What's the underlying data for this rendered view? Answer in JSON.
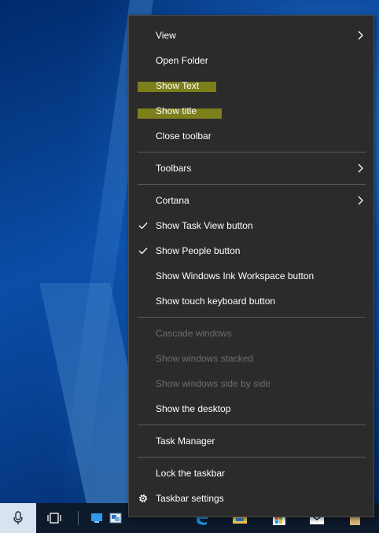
{
  "context_menu": {
    "items": [
      {
        "label": "View"
      },
      {
        "label": "Open Folder"
      },
      {
        "label": "Show Text"
      },
      {
        "label": "Show title"
      },
      {
        "label": "Close toolbar"
      },
      {
        "label": "Toolbars"
      },
      {
        "label": "Cortana"
      },
      {
        "label": "Show Task View button"
      },
      {
        "label": "Show People button"
      },
      {
        "label": "Show Windows Ink Workspace button"
      },
      {
        "label": "Show touch keyboard button"
      },
      {
        "label": "Cascade windows"
      },
      {
        "label": "Show windows stacked"
      },
      {
        "label": "Show windows side by side"
      },
      {
        "label": "Show the desktop"
      },
      {
        "label": "Task Manager"
      },
      {
        "label": "Lock the taskbar"
      },
      {
        "label": "Taskbar settings"
      }
    ],
    "checked_items": [
      "Show Task View button",
      "Show People button"
    ],
    "disabled_items": [
      "Cascade windows",
      "Show windows stacked",
      "Show windows side by side"
    ],
    "highlighted_items": [
      "Show Text",
      "Show title"
    ],
    "highlight_color": "#7c7f1a",
    "background_color": "#2b2b2b"
  },
  "taskbar": {
    "icons": [
      "microphone-icon",
      "task-view-icon",
      "app-icon",
      "app-icon",
      "edge-icon",
      "file-explorer-icon",
      "store-icon",
      "mail-icon",
      "app-icon"
    ]
  }
}
